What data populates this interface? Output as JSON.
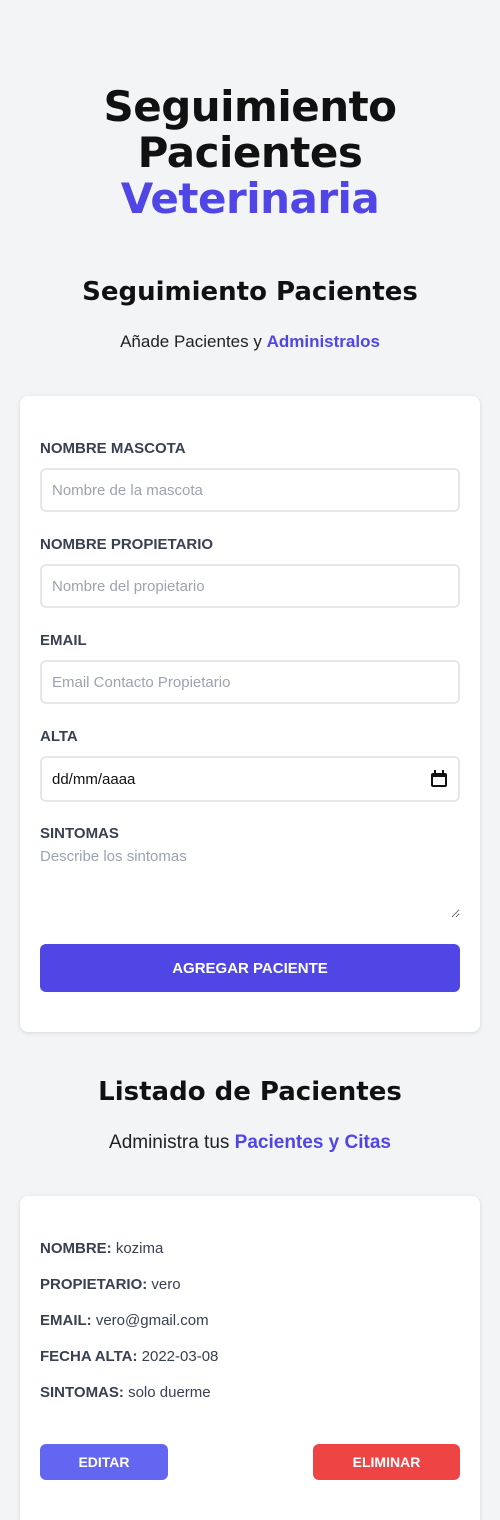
{
  "header": {
    "title_line1": "Seguimiento",
    "title_line2": "Pacientes",
    "title_accent": "Veterinaria"
  },
  "form_section": {
    "title": "Seguimiento Pacientes",
    "subtitle_prefix": "Añade Pacientes y ",
    "subtitle_accent": "Administralos"
  },
  "form": {
    "pet_name": {
      "label": "Nombre Mascota",
      "placeholder": "Nombre de la mascota",
      "value": ""
    },
    "owner_name": {
      "label": "Nombre Propietario",
      "placeholder": "Nombre del propietario",
      "value": ""
    },
    "email": {
      "label": "Email",
      "placeholder": "Email Contacto Propietario",
      "value": ""
    },
    "discharge": {
      "label": "Alta",
      "value": "dd/mm/aaaa",
      "icon": "calendar-icon"
    },
    "symptoms": {
      "label": "Sintomas",
      "placeholder": "Describe los sintomas",
      "value": ""
    },
    "submit_label": "Agregar Paciente"
  },
  "list_section": {
    "title": "Listado de Pacientes",
    "subtitle_prefix": "Administra tus ",
    "subtitle_accent": "Pacientes y Citas"
  },
  "patients": [
    {
      "name_label": "Nombre:",
      "name": "kozima",
      "owner_label": "Propietario:",
      "owner": "vero",
      "email_label": "Email:",
      "email": "vero@gmail.com",
      "date_label": "Fecha Alta:",
      "date": "2022-03-08",
      "symptoms_label": "Sintomas:",
      "symptoms": "solo duerme",
      "edit_label": "Editar",
      "delete_label": "Eliminar"
    }
  ],
  "colors": {
    "accent": "#4f46e5",
    "edit": "#6366f1",
    "delete": "#ef4444",
    "background": "#f3f4f6"
  }
}
